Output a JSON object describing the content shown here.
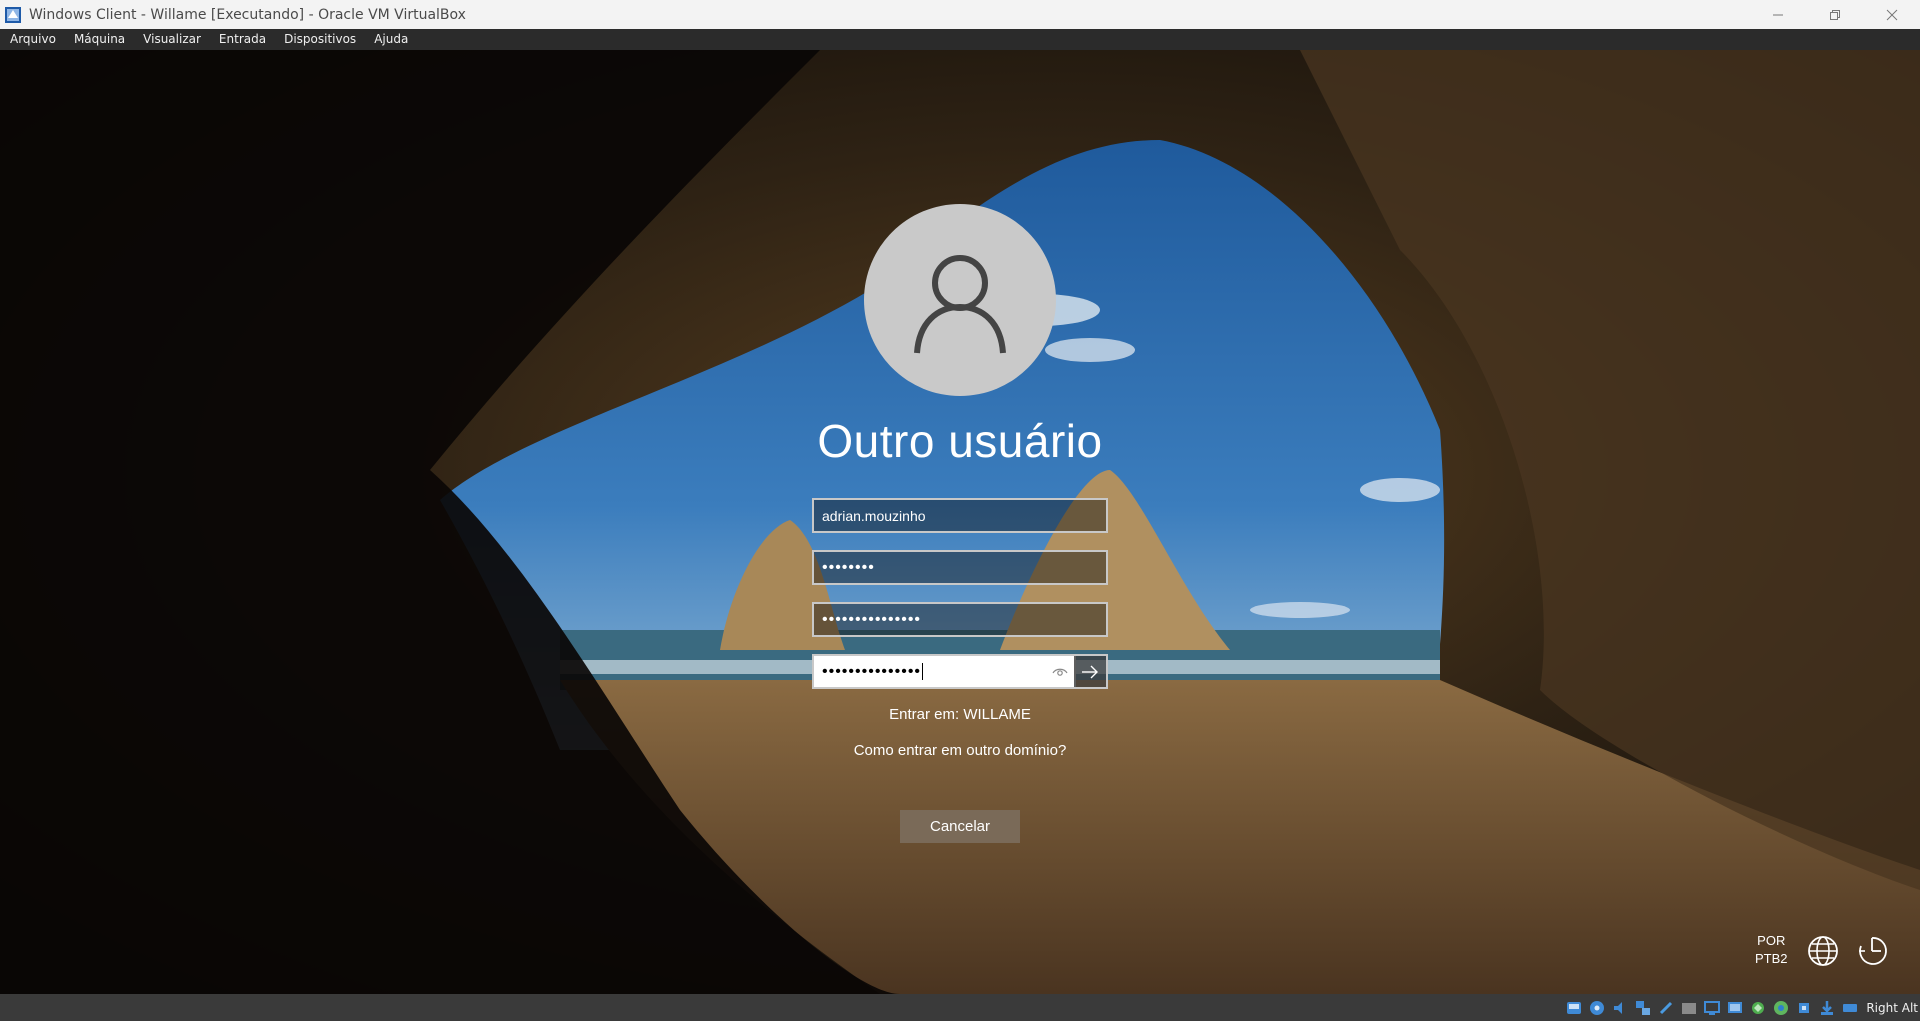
{
  "window": {
    "title": "Windows Client - Willame [Executando] - Oracle VM VirtualBox"
  },
  "menu": [
    "Arquivo",
    "Máquina",
    "Visualizar",
    "Entrada",
    "Dispositivos",
    "Ajuda"
  ],
  "login": {
    "title": "Outro usuário",
    "username_value": "adrian.mouzinho",
    "current_password_dots": "••••••••",
    "new_password_dots": "•••••••••••••••",
    "confirm_password_dots": "•••••••••••••••",
    "sign_in_to": "Entrar em: WILLAME",
    "other_domain_link": "Como entrar em outro domínio?",
    "cancel_label": "Cancelar"
  },
  "system_tray": {
    "language_line1": "POR",
    "language_line2": "PTB2"
  },
  "statusbar": {
    "host_key_label": "Right Alt",
    "icons": [
      "hard-disk-icon",
      "optical-drive-icon",
      "audio-icon",
      "network-icon",
      "usb-icon",
      "shared-folders-icon",
      "display-icon",
      "capture-icon",
      "recording-icon",
      "guest-additions-icon",
      "cpu-icon",
      "mouse-integration-icon",
      "keyboard-capture-icon"
    ]
  }
}
